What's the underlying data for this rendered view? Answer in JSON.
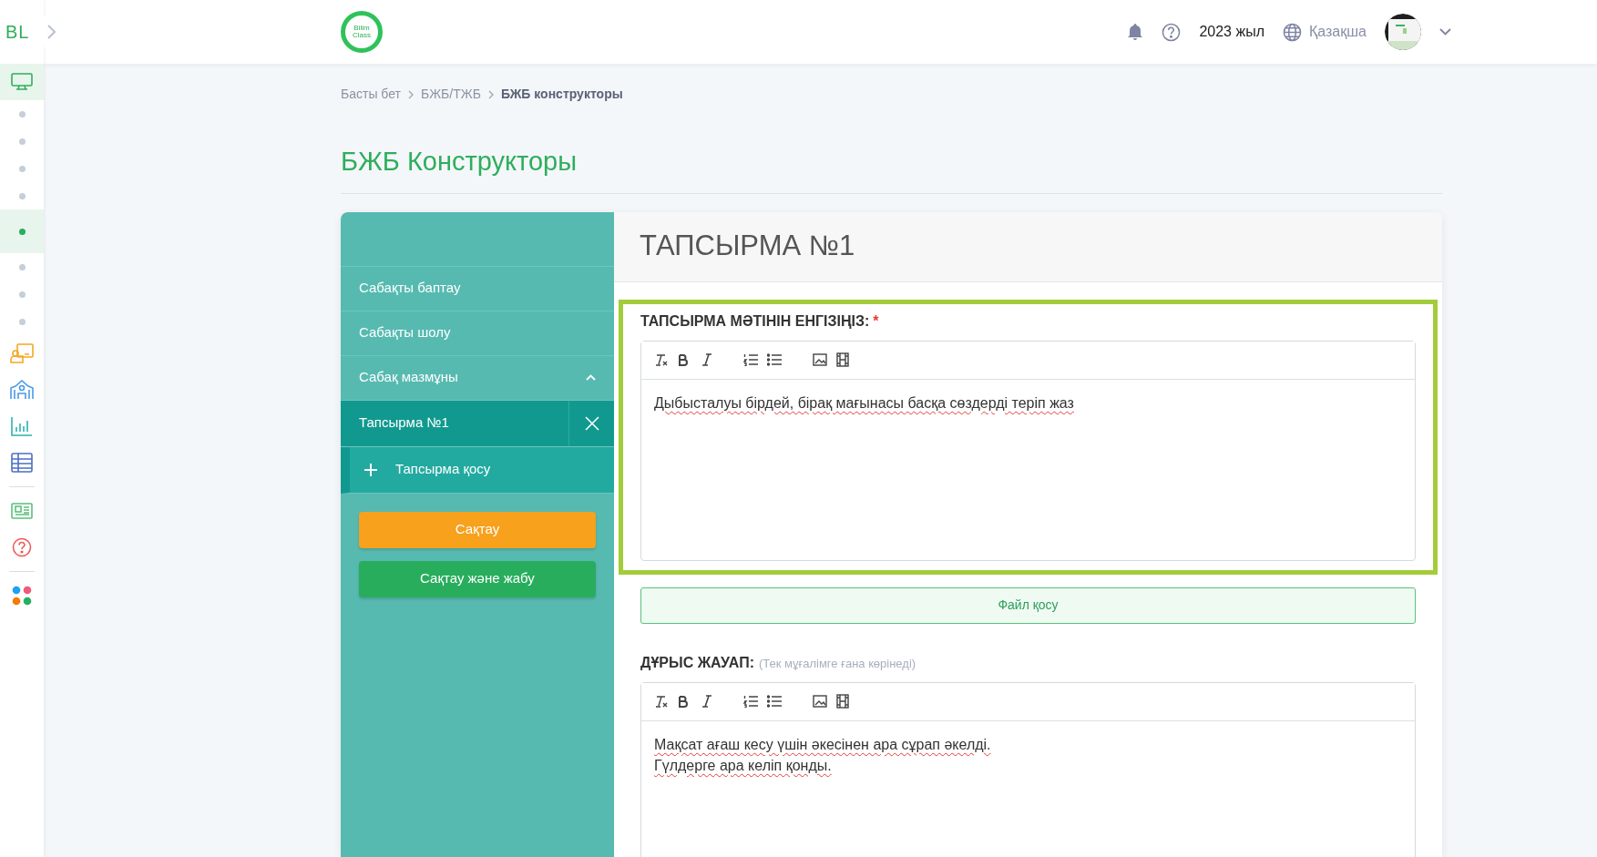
{
  "rail": {
    "logo": "BL",
    "items": [
      {
        "kind": "monitor",
        "selected": true
      },
      {
        "kind": "dot",
        "selected": false
      },
      {
        "kind": "dot",
        "selected": false
      },
      {
        "kind": "dot",
        "selected": false
      },
      {
        "kind": "dot",
        "selected": false
      },
      {
        "kind": "dot",
        "selected": true
      },
      {
        "kind": "dot",
        "selected": false
      },
      {
        "kind": "dot",
        "selected": false
      },
      {
        "kind": "dot",
        "selected": false
      },
      {
        "kind": "presentation",
        "selected": false
      },
      {
        "kind": "school",
        "selected": false
      },
      {
        "kind": "chart",
        "selected": false
      },
      {
        "kind": "table",
        "selected": false
      },
      {
        "kind": "divider"
      },
      {
        "kind": "news",
        "selected": false
      },
      {
        "kind": "help",
        "selected": false
      },
      {
        "kind": "divider"
      },
      {
        "kind": "apps",
        "selected": false
      }
    ]
  },
  "header": {
    "logo_text": "Bilim Class",
    "year": "2023 жыл",
    "language": "Қазақша"
  },
  "breadcrumb": [
    {
      "label": "Басты бет",
      "current": false
    },
    {
      "label": "БЖБ/ТЖБ",
      "current": false
    },
    {
      "label": "БЖБ конструкторы",
      "current": true
    }
  ],
  "page_title": "БЖБ Конструкторы",
  "menu": {
    "items": [
      {
        "kind": "link",
        "label": "Сабақты баптау",
        "selected": false
      },
      {
        "kind": "link",
        "label": "Сабақты шолу",
        "selected": false
      },
      {
        "kind": "group",
        "label": "Сабақ мазмұны",
        "expanded": true,
        "selected": false
      },
      {
        "kind": "task",
        "label": "Тапсырма №1",
        "selected": true
      }
    ],
    "add_label": "Тапсырма қосу",
    "save": "Сақтау",
    "save_close": "Сақтау және жабу"
  },
  "task": {
    "title": "ТАПСЫРМА №1",
    "question": {
      "label": "ТАПСЫРМА МӘТІНІН ЕНГІЗІҢІЗ:",
      "required": true,
      "required_mark": "*",
      "highlighted": true,
      "lines": [
        "Дыбысталуы бірдей, бірақ мағынасы басқа сөздерді теріп жаз"
      ]
    },
    "file_button": "Файл қосу",
    "answer": {
      "label": "ДҰРЫС ЖАУАП:",
      "hint": "(Тек мұғалімге ғана көрінеді)",
      "lines": [
        "Мақсат ағаш кесу үшін әкесінен ара сұрап әкелді.",
        "Гүлдерге ара келіп қонды."
      ]
    }
  }
}
